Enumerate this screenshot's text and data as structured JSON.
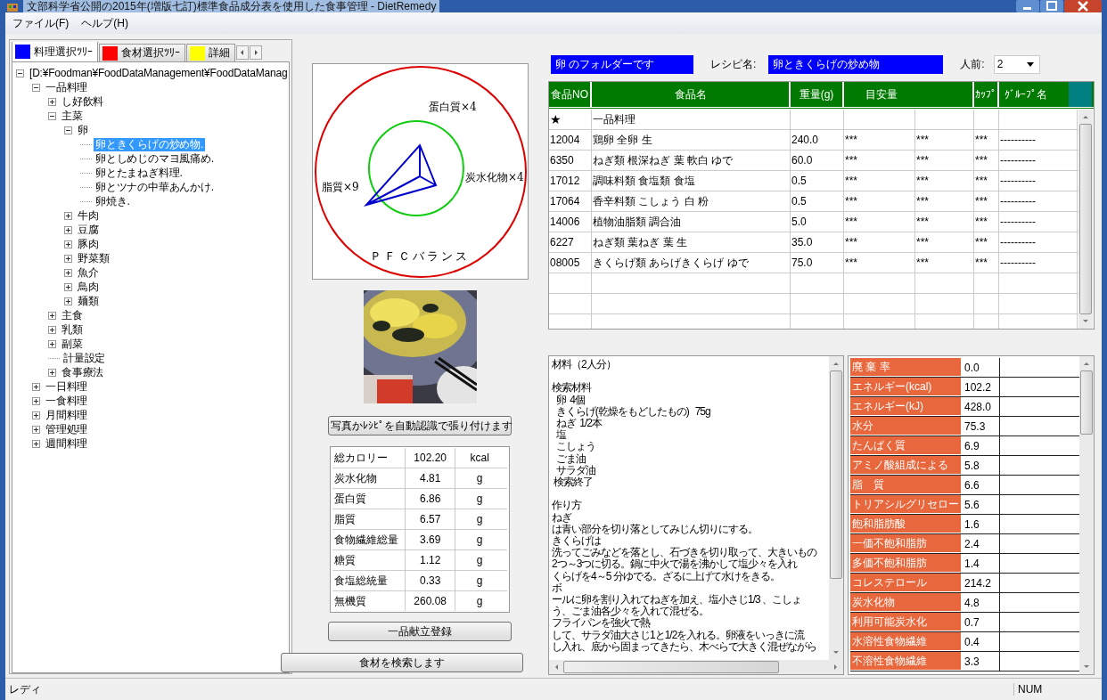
{
  "window": {
    "title": "文部科学省公開の2015年(増版七訂)標準食品成分表を使用した食事管理 - DietRemedy"
  },
  "menu": [
    "ファイル(F)",
    "ヘルプ(H)"
  ],
  "tabs": [
    {
      "label": "料理選択ﾂﾘｰ",
      "color": "#0000ff",
      "selected": true
    },
    {
      "label": "食材選択ﾂﾘｰ",
      "color": "#ff0000",
      "selected": false
    },
    {
      "label": "詳細",
      "color": "#ffff00",
      "selected": false
    }
  ],
  "tree": {
    "items": [
      {
        "label": "[D:¥Foodman¥FoodDataManagement¥FoodDataManag",
        "expanded": true,
        "selected": false,
        "children": [
          {
            "label": "一品料理",
            "expanded": true,
            "selected": false,
            "children": [
              {
                "label": "し好飲料",
                "expanded": false,
                "selected": false
              },
              {
                "label": "主菜",
                "expanded": true,
                "selected": false,
                "children": [
                  {
                    "label": "卵",
                    "expanded": true,
                    "selected": false,
                    "children": [
                      {
                        "label": "卵ときくらげの炒め物.",
                        "selected": true
                      },
                      {
                        "label": "卵としめじのマヨ風痛め.",
                        "selected": false
                      },
                      {
                        "label": "卵とたまねぎ料理.",
                        "selected": false
                      },
                      {
                        "label": "卵とツナの中華あんかけ.",
                        "selected": false
                      },
                      {
                        "label": "卵焼き.",
                        "selected": false
                      }
                    ]
                  },
                  {
                    "label": "牛肉",
                    "expanded": false,
                    "selected": false
                  },
                  {
                    "label": "豆腐",
                    "expanded": false,
                    "selected": false
                  },
                  {
                    "label": "豚肉",
                    "expanded": false,
                    "selected": false
                  },
                  {
                    "label": "野菜類",
                    "expanded": false,
                    "selected": false
                  },
                  {
                    "label": "魚介",
                    "expanded": false,
                    "selected": false
                  },
                  {
                    "label": "鳥肉",
                    "expanded": false,
                    "selected": false
                  },
                  {
                    "label": "麺類",
                    "expanded": false,
                    "selected": false
                  }
                ]
              },
              {
                "label": "主食",
                "expanded": false,
                "selected": false
              },
              {
                "label": "乳類",
                "expanded": false,
                "selected": false
              },
              {
                "label": "副菜",
                "expanded": false,
                "selected": false
              },
              {
                "label": "計量設定",
                "selected": false
              },
              {
                "label": "食事療法",
                "expanded": false,
                "selected": false
              }
            ]
          },
          {
            "label": "一日料理",
            "expanded": false,
            "selected": false
          },
          {
            "label": "一食料理",
            "expanded": false,
            "selected": false
          },
          {
            "label": "月間料理",
            "expanded": false,
            "selected": false
          },
          {
            "label": "管理処理",
            "expanded": false,
            "selected": false
          },
          {
            "label": "週間料理",
            "expanded": false,
            "selected": false
          }
        ]
      }
    ]
  },
  "pfc": {
    "title": "ＰＦＣバランス",
    "labels": [
      "蛋白質×4",
      "炭水化物×4",
      "脂質×9"
    ]
  },
  "photo": {
    "kind": "picture"
  },
  "auto_button": "写真かﾚｼﾋﾟを自動認識で張り付けます",
  "summary": [
    {
      "label": "総カロリー",
      "value": "102.20",
      "unit": "kcal"
    },
    {
      "label": "炭水化物",
      "value": "4.81",
      "unit": "g"
    },
    {
      "label": "蛋白質",
      "value": "6.86",
      "unit": "g"
    },
    {
      "label": "脂質",
      "value": "6.57",
      "unit": "g"
    },
    {
      "label": "食物繊維総量",
      "value": "3.69",
      "unit": "g"
    },
    {
      "label": "糖質",
      "value": "1.12",
      "unit": "g"
    },
    {
      "label": "食塩総統量",
      "value": "0.33",
      "unit": "g"
    },
    {
      "label": "無機質",
      "value": "260.08",
      "unit": "g"
    }
  ],
  "register_button": "一品献立登録",
  "search_button": "食材を検索します",
  "folder_label": "卵 のフォルダーです",
  "recipe_label": "レシピ名:",
  "recipe_name": "卵ときくらげの炒め物",
  "servings_label": "人前:",
  "servings": "2",
  "table": {
    "columns": [
      {
        "label": "食品NO"
      },
      {
        "label": "食品名"
      },
      {
        "label": "重量(g)"
      },
      {
        "label": "目安量"
      },
      {
        "label": "ｶｯﾌﾟ"
      },
      {
        "label": "ｸﾞﾙｰﾌﾟ名"
      }
    ],
    "rows": [
      [
        "★",
        "一品料理"
      ],
      [
        "12004",
        "鶏卵 全卵 生",
        "240.0",
        [
          "***",
          "***"
        ],
        "***",
        "----------"
      ],
      [
        "6350",
        "ねぎ類 根深ねぎ 葉 軟白 ゆで",
        "60.0",
        [
          "***",
          "***"
        ],
        "***",
        "----------"
      ],
      [
        "17012",
        "調味料類 食塩類 食塩",
        "0.5",
        [
          "***",
          "***"
        ],
        "***",
        "----------"
      ],
      [
        "17064",
        "香辛料類 こしょう 白 粉",
        "0.5",
        [
          "***",
          "***"
        ],
        "***",
        "----------"
      ],
      [
        "14006",
        "植物油脂類 調合油",
        "5.0",
        [
          "***",
          "***"
        ],
        "***",
        "----------"
      ],
      [
        "6227",
        "ねぎ類 葉ねぎ 葉 生",
        "35.0",
        [
          "***",
          "***"
        ],
        "***",
        "----------"
      ],
      [
        "08005",
        "きくらげ類 あらげきくらげ ゆで",
        "75.0",
        [
          "***",
          "***"
        ],
        "***",
        "----------"
      ]
    ]
  },
  "recipe_text": [
    [
      "材料（2人分）"
    ],
    [
      "検索材料",
      "  卵  4個",
      "  きくらげ(乾燥をもどしたもの)   75g",
      "  ねぎ  1/2本",
      "  塩",
      "  こしょう",
      "  ごま油",
      "  サラダ油",
      " 検索終了"
    ],
    [
      "作り方",
      "ねぎ",
      "は青い部分を切り落としてみじん切りにする。",
      "きくらげは",
      "洗ってごみなどを落とし、石づきを切り取って、大きいもの",
      "2つ～3つに切る。鍋に中火で湯を沸かして塩少々を入れ",
      "くらげを4～5 分ゆでる。ざるに上げて水けをきる。",
      "ボ",
      "ールに卵を割り入れてねぎを加え、塩小さじ1/3 、こしょ",
      "う、ごま油各少々を入れて混ぜる。",
      "フライパンを強火で熱",
      "して、サラダ油大さじ1と1/2を入れる。卵液をいっきに流",
      "し入れ、底から固まってきたら、木べらで大きく混ぜながら"
    ]
  ],
  "nutrients": [
    {
      "label": "廃 棄 率",
      "value": "0.0"
    },
    {
      "label": "エネルギー(kcal)",
      "value": "102.2"
    },
    {
      "label": "エネルギー(kJ)",
      "value": "428.0"
    },
    {
      "label": "水分",
      "value": "75.3"
    },
    {
      "label": "たんぱく質",
      "value": "6.9"
    },
    {
      "label": "アミノ酸組成による",
      "value": "5.8"
    },
    {
      "label": "脂　質",
      "value": "6.6"
    },
    {
      "label": "トリアシルグリセロー",
      "value": "5.6"
    },
    {
      "label": "飽和脂肪酸",
      "value": "1.6"
    },
    {
      "label": "一価不飽和脂肪",
      "value": "2.4"
    },
    {
      "label": "多価不飽和脂肪",
      "value": "1.4"
    },
    {
      "label": "コレステロール",
      "value": "214.2"
    },
    {
      "label": "炭水化物",
      "value": "4.8"
    },
    {
      "label": "利用可能炭水化",
      "value": "0.7"
    },
    {
      "label": "水溶性食物繊維",
      "value": "0.4"
    },
    {
      "label": "不溶性食物繊維",
      "value": "3.3"
    }
  ],
  "status_bar": {
    "left": "レディ",
    "right": "NUM"
  }
}
